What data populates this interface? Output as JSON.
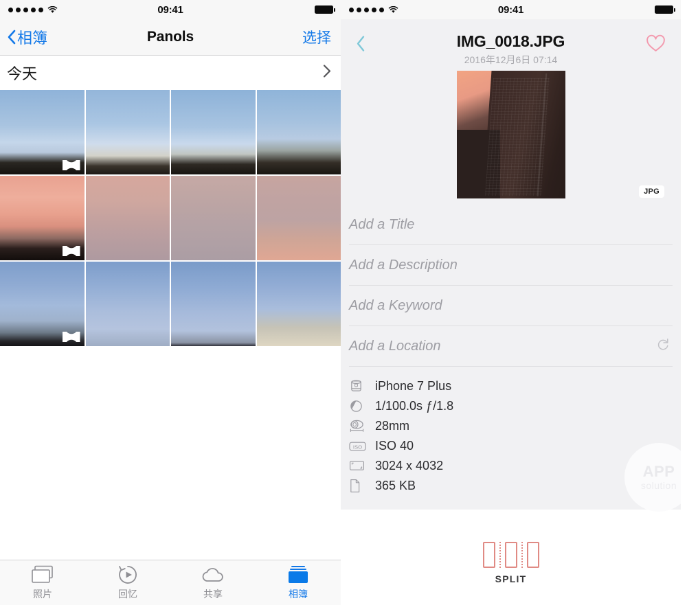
{
  "status_bar": {
    "signal_dots": 5,
    "wifi_icon": "wifi-icon",
    "time": "09:41",
    "battery_icon": "battery-full-icon"
  },
  "left_pane": {
    "nav": {
      "back_label": "相簿",
      "back_icon": "chevron-left-icon",
      "title": "Panols",
      "action_label": "选择"
    },
    "section": {
      "title": "今天",
      "chevron_icon": "chevron-right-icon"
    },
    "grid": {
      "badge_icon": "panorama-badge-icon",
      "cells": [
        {
          "id": "photo-1",
          "badge": true,
          "sky": "linear-gradient(to bottom,#8fb3d9 0%,#a9c4e0 42%,#c4d6ea 62%,#b9c9dd 74%,#2a2722 86%,#15120f 100%)"
        },
        {
          "id": "photo-2",
          "badge": false,
          "sky": "linear-gradient(to bottom,#94b6da 0%,#aac6e3 40%,#cfdcec 64%,#d3d2c9 78%,#3a342c 90%,#1d1914 100%)"
        },
        {
          "id": "photo-3",
          "badge": false,
          "sky": "linear-gradient(to bottom,#8db2d8 0%,#a8c4e1 44%,#c9d9ec 64%,#c1c6c2 76%,#2f2a24 88%,#171410 100%)"
        },
        {
          "id": "photo-4",
          "badge": false,
          "sky": "linear-gradient(to bottom,#8fb4d9 0%,#a6c2df 38%,#b8cbe2 58%,#9aa3a0 72%,#342e27 86%,#191611 100%)"
        },
        {
          "id": "photo-5",
          "badge": true,
          "sky": "linear-gradient(to bottom,#e9a291 0%,#eeae9c 26%,#e8a08d 46%,#d9907f 60%,#8d6a62 74%,#2a1f1d 86%,#120d0c 100%)"
        },
        {
          "id": "photo-6",
          "badge": false,
          "sky": "linear-gradient(to bottom,#d6a79d 0%,#cfa79f 30%,#c2a19f 55%,#b79da0 78%,#ae9aa0 100%)"
        },
        {
          "id": "photo-7",
          "badge": false,
          "sky": "linear-gradient(to bottom,#c6a9a5 0%,#bda5a4 30%,#b5a2a5 58%,#b0a0a5 80%,#ab9da4 100%)"
        },
        {
          "id": "photo-8",
          "badge": false,
          "sky": "linear-gradient(to bottom,#c7a5a0 0%,#c0a3a2 28%,#bda3a3 52%,#cfa596 76%,#e0a794 100%)"
        },
        {
          "id": "photo-9",
          "badge": true,
          "sky": "linear-gradient(to bottom,#7e9ecb 0%,#90abd3 28%,#a3badb 52%,#9fb2cc 70%,#6d7a88 84%,#26262a 94%,#131316 100%)"
        },
        {
          "id": "photo-10",
          "badge": false,
          "sky": "linear-gradient(to bottom,#7d9dcb 0%,#93aed5 30%,#aabddc 58%,#b5c4de 80%,#9fadc4 100%)"
        },
        {
          "id": "photo-11",
          "badge": false,
          "sky": "linear-gradient(to bottom,#7a9bc9 0%,#8fabd4 32%,#a6badb 60%,#b2c2dd 82%,#8a93a4 96%,#30303a 100%)"
        },
        {
          "id": "photo-12",
          "badge": false,
          "sky": "linear-gradient(to bottom,#7d9ecb 0%,#93add5 30%,#a9bddc 56%,#c6c3b6 78%,#ded6c2 100%)"
        }
      ]
    },
    "tabbar": {
      "items": [
        {
          "label": "照片",
          "icon": "photos-icon",
          "active": false
        },
        {
          "label": "回忆",
          "icon": "memories-icon",
          "active": false
        },
        {
          "label": "共享",
          "icon": "shared-cloud-icon",
          "active": false
        },
        {
          "label": "相簿",
          "icon": "albums-icon",
          "active": true
        }
      ]
    }
  },
  "right_pane": {
    "nav": {
      "back_icon": "chevron-left-icon",
      "title": "IMG_0018.JPG",
      "subtitle": "2016年12月6日 07:14",
      "favorite_icon": "heart-outline-icon"
    },
    "photo": {
      "format_badge": "JPG",
      "alt_name": "photo-preview"
    },
    "fields": [
      {
        "name": "title-field",
        "placeholder": "Add a Title",
        "value": ""
      },
      {
        "name": "description-field",
        "placeholder": "Add a Description",
        "value": ""
      },
      {
        "name": "keyword-field",
        "placeholder": "Add a Keyword",
        "value": ""
      },
      {
        "name": "location-field",
        "placeholder": "Add a Location",
        "value": "",
        "action_icon": "refresh-icon"
      }
    ],
    "exif": [
      {
        "icon": "camera-body-icon",
        "value": "iPhone 7 Plus"
      },
      {
        "icon": "aperture-icon",
        "value": "1/100.0s ƒ/1.8"
      },
      {
        "icon": "lens-icon",
        "value": "28mm"
      },
      {
        "icon": "iso-icon",
        "value": "ISO 40"
      },
      {
        "icon": "dimensions-icon",
        "value": "3024 x 4032"
      },
      {
        "icon": "file-icon",
        "value": "365 KB"
      }
    ],
    "watermark": {
      "line1": "APP",
      "line2": "solution"
    },
    "split_button": {
      "label": "SPLIT",
      "icon": "split-icon",
      "color": "#e08a84"
    }
  },
  "colors": {
    "accent_blue": "#1278e8",
    "nav_bg": "#f7f7f7",
    "panel_bg": "#f1f1f3",
    "heart_pink": "#f39aae",
    "back_teal": "#7ec8d8",
    "split_salmon": "#e08a84",
    "muted_text": "#8e8e93"
  }
}
